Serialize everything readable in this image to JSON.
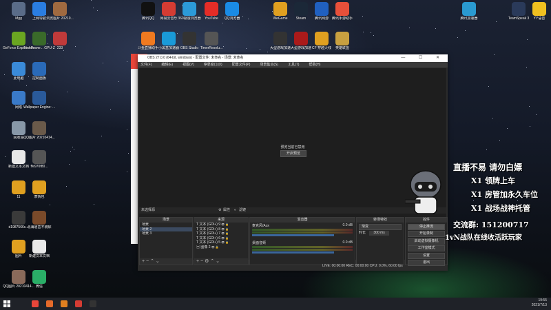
{
  "desktop_icons": [
    {
      "label": "Mgg",
      "color": "#5a6c88"
    },
    {
      "label": "上网导航",
      "color": "#2a7de1"
    },
    {
      "label": "浏览图片 20210...",
      "color": "#a06a40"
    },
    {
      "label": "腾讯QQ",
      "color": "#111111"
    },
    {
      "label": "网易云音乐",
      "color": "#d43c33"
    },
    {
      "label": "360极速浏览器",
      "color": "#2c9ad8"
    },
    {
      "label": "YouTube",
      "color": "#e52d27"
    },
    {
      "label": "QQ浏览器",
      "color": "#1a8be5"
    },
    {
      "label": "WeGame",
      "color": "#e0a020"
    },
    {
      "label": "Steam",
      "color": "#1b2838"
    },
    {
      "label": "腾讯网游",
      "color": "#2060c0"
    },
    {
      "label": "腾讯手游助手",
      "color": "#e8503a"
    },
    {
      "label": "腾讯加速器",
      "color": "#2a9ad0"
    },
    {
      "label": "TeamSpeak 3",
      "color": "#2a3a5a"
    },
    {
      "label": "YY语音",
      "color": "#f0c020"
    },
    {
      "label": "GeForce Experience",
      "color": "#6aa521"
    },
    {
      "label": "TechPower... GPU-Z",
      "color": "#3a6a2a"
    },
    {
      "label": "233",
      "color": "#c03a3a"
    },
    {
      "label": "斗鱼直播助手",
      "color": "#f07a20"
    },
    {
      "label": "小黑盒加速器",
      "color": "#1a9ad8"
    },
    {
      "label": "OBS Studio",
      "color": "#333333"
    },
    {
      "label": "TimerResolu...",
      "color": "#555555"
    },
    {
      "label": "大型游戏加速",
      "color": "#333333"
    },
    {
      "label": "大型游戏加速",
      "color": "#aa1a1a"
    },
    {
      "label": "CF 穿越火线",
      "color": "#e0a020"
    },
    {
      "label": "英雄联盟",
      "color": "#c8a040"
    },
    {
      "label": "此电脑",
      "color": "#3a8ad8"
    },
    {
      "label": "控制面板",
      "color": "#2a6ab8"
    },
    {
      "label": "网络",
      "color": "#3a7ac8"
    },
    {
      "label": "Wallpaper Engine: ...",
      "color": "#2a5a9a"
    },
    {
      "label": "回收站",
      "color": "#8898a8"
    },
    {
      "label": "QQ图片 20210414...",
      "color": "#6a5a4a"
    },
    {
      "label": "新建文本文档",
      "color": "#e8e8e8"
    },
    {
      "label": "ffe970f80...",
      "color": "#555555"
    },
    {
      "label": "11",
      "color": "#e0a020"
    },
    {
      "label": "表情包",
      "color": "#e0a020"
    },
    {
      "label": "d1987566c...",
      "color": "#3a3a3a"
    },
    {
      "label": "北海道岳不剔除",
      "color": "#7a4a2a"
    },
    {
      "label": "图片",
      "color": "#e0a020"
    },
    {
      "label": "新建文本文档",
      "color": "#e8e8e8"
    },
    {
      "label": "QQ图片 20210414...",
      "color": "#8a6a5a"
    },
    {
      "label": "微信",
      "color": "#2aae67"
    }
  ],
  "obs": {
    "title": "OBS 27.0.0 (64-bit, windows) - 配置文件: 未命名 - 场景: 未命名",
    "window_buttons": "— ☐ ✕",
    "menu": [
      "文件(F)",
      "编辑(E)",
      "视图(V)",
      "停靠窗口(D)",
      "配置文件(P)",
      "场景集合(S)",
      "工具(T)",
      "帮助(H)"
    ],
    "preview_message": "预览当前已禁用",
    "preview_button": "开启预览",
    "source_status": "未选择源",
    "properties_button": "属性",
    "filters_button": "滤镜",
    "scenes_header": "场景",
    "scenes": [
      "场景",
      "场景 2",
      "场景 3"
    ],
    "sources_header": "来源",
    "sources": [
      "文本 (GDI+) 9",
      "文本 (GDI+) 8",
      "文本 (GDI+) 7",
      "文本 (GDI+) 6",
      "文本 (GDI+) 5",
      "图像 2"
    ],
    "mixer_header": "混音器",
    "mixer_channels": [
      {
        "name": "麦克风/Aux",
        "db": "0.0 dB"
      },
      {
        "name": "桌面音频",
        "db": "0.0 dB"
      }
    ],
    "transition_header": "转场特效",
    "transition_type": "渐变",
    "duration_label": "时长",
    "duration_value": "300 ms",
    "controls_header": "控件",
    "controls": [
      "停止推流",
      "开始录制",
      "启动虚拟摄像机",
      "工作室模式",
      "设置",
      "退出"
    ],
    "status_bar": "LIVE: 00:00:00   REC: 00:00:00   CPU: 0.0%, 60.00 fps"
  },
  "overlay": {
    "headline": "直播不易 请勿白嫖",
    "perk1": "X1 领牌上车",
    "perk2": "X1 房管加永久车位",
    "perk3": "X1 战场战神托管",
    "group": "交流群: 151200717",
    "slogan": "1vN战队在线收活跃玩家"
  },
  "taskbar": {
    "time": "19:55",
    "date": "2021/7/13",
    "app_colors": [
      "#e8463a",
      "#e56a2a",
      "#e08020",
      "#d43c33",
      "#333333"
    ]
  }
}
